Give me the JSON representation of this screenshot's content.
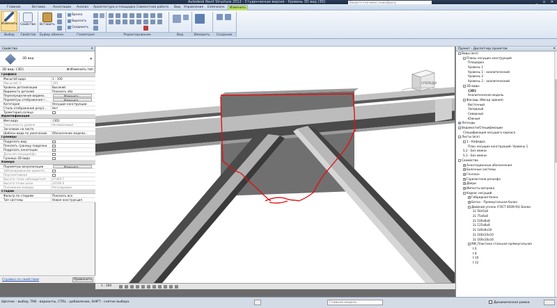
{
  "window": {
    "title": "Autodesk Revit Structure 2012 - Студенческая версия - Уровень 3D вид (3D)",
    "search_placeholder": "Введите ключевое слово/фразу",
    "controls": "_ ▫ ✕"
  },
  "ribbon_tabs": [
    "Главная",
    "Вставка",
    "Аннотации",
    "Анализ",
    "Архитектура и площадка",
    "Совместная работа",
    "Вид",
    "Управление",
    "Extensions",
    "Изменить"
  ],
  "ribbon": {
    "modify_label": "Изменить",
    "panels": {
      "select": "Выбор",
      "properties": "Свойства",
      "clipboard": "Буфер обмена",
      "geometry": "Геометрия",
      "modify": "Редактирование",
      "view": "Вид",
      "measure": "Измерить",
      "create": "Создание"
    },
    "buttons": {
      "properties": "Свойства",
      "paste": "Вставить",
      "cut": "Вырезать",
      "join": "Соединить",
      "cope": "Врезка"
    }
  },
  "properties": {
    "header": "Свойства",
    "type_name": "3D вид",
    "selector": "3D вид: {3D}",
    "edit_type": "Изменить тип",
    "groups": [
      {
        "name": "Графика",
        "rows": [
          {
            "n": "Масштаб вида",
            "v": "1 : 100",
            "kind": "text"
          },
          {
            "n": "Масштаб: 1:",
            "v": "100",
            "kind": "text",
            "dim": true
          },
          {
            "n": "Уровень детализации",
            "v": "Высокий",
            "kind": "text"
          },
          {
            "n": "Видимость деталей",
            "v": "Показать обо",
            "kind": "text"
          },
          {
            "n": "Переопределения видимо...",
            "v": "Изменить...",
            "kind": "btn"
          },
          {
            "n": "Параметры отображения г...",
            "v": "Изменить...",
            "kind": "btn"
          },
          {
            "n": "Категория",
            "v": "Несущие конструкции",
            "kind": "text"
          },
          {
            "n": "Стиль отображения резул...",
            "v": "Нет",
            "kind": "text"
          },
          {
            "n": "Траектория солнца",
            "v": "",
            "kind": "chk"
          }
        ]
      },
      {
        "name": "Идентификация",
        "rows": [
          {
            "n": "Имя вида",
            "v": "{3D}",
            "kind": "text"
          },
          {
            "n": "Зависимость уровня",
            "v": "Независимый",
            "kind": "text",
            "dim": true
          },
          {
            "n": "Заголовок на листе",
            "v": "",
            "kind": "text"
          },
          {
            "n": "Шаблон вида по умолчанию",
            "v": "Обозначение модели...",
            "kind": "text"
          }
        ]
      },
      {
        "name": "Границы",
        "rows": [
          {
            "n": "Подрезать вид",
            "v": "",
            "kind": "chk"
          },
          {
            "n": "Показать границу подрезки",
            "v": "",
            "kind": "chk"
          },
          {
            "n": "Подрезать аннотации",
            "v": "",
            "kind": "chk"
          },
          {
            "n": "Дальняя секущая(фн",
            "v": "",
            "kind": "chk",
            "dim": true
          },
          {
            "n": "Граница 3D вида",
            "v": "",
            "kind": "chk"
          }
        ]
      },
      {
        "name": "Камера",
        "rows": [
          {
            "n": "Параметры визуализации",
            "v": "Изменить...",
            "kind": "btn"
          },
          {
            "n": "Заблокированная ориента...",
            "v": "",
            "kind": "chk",
            "dim": true
          },
          {
            "n": "Перспективная",
            "v": "",
            "kind": "chk",
            "dim": true
          },
          {
            "n": "Высота глаза наблюдателя",
            "v": "67464.7",
            "kind": "text",
            "dim": true
          },
          {
            "n": "Высота точки цели",
            "v": "24190.0",
            "kind": "text",
            "dim": true
          },
          {
            "n": "Положение камеры",
            "v": "Регулировка",
            "kind": "text",
            "dim": true
          }
        ]
      },
      {
        "name": "Стадии",
        "rows": [
          {
            "n": "Фильтр по стадиям",
            "v": "Показать все",
            "kind": "text"
          },
          {
            "n": "Тип системы",
            "v": "Новая конструкция",
            "kind": "text"
          }
        ]
      }
    ],
    "help_link": "Справка по свойствам",
    "apply": "Применить"
  },
  "viewport": {
    "scale": "1 : 100",
    "viewcube_label": "СПЕРЕДИ",
    "colors": {
      "steel_light": "#b9b9b9",
      "steel_dark": "#3d3d3d",
      "plate": "#6f6f6f",
      "markup": "#e01010"
    }
  },
  "browser": {
    "header": "Проект - Диспетчер проектов",
    "tree": [
      {
        "t": "Виды (все)",
        "lvl": 0,
        "exp": "-"
      },
      {
        "t": "Планы несущих конструкций",
        "lvl": 1,
        "exp": "-"
      },
      {
        "t": "Площадка",
        "lvl": 2
      },
      {
        "t": "Уровень 1",
        "lvl": 2
      },
      {
        "t": "Уровень 1 - аналитический",
        "lvl": 2
      },
      {
        "t": "Уровень 2",
        "lvl": 2
      },
      {
        "t": "Уровень 2 - аналитический",
        "lvl": 2
      },
      {
        "t": "3D виды",
        "lvl": 1,
        "exp": "-"
      },
      {
        "t": "{3D}",
        "lvl": 2,
        "bold": true
      },
      {
        "t": "Аналитическая модель",
        "lvl": 2
      },
      {
        "t": "Фасады (Фасад здания)",
        "lvl": 1,
        "exp": "-"
      },
      {
        "t": "Восточный",
        "lvl": 2
      },
      {
        "t": "Западный",
        "lvl": 2
      },
      {
        "t": "Северный",
        "lvl": 2
      },
      {
        "t": "Южный",
        "lvl": 2
      },
      {
        "t": "Легенды",
        "lvl": 0,
        "ico": true
      },
      {
        "t": "Ведомости/Спецификации",
        "lvl": 0,
        "exp": "-"
      },
      {
        "t": "Спецификация несущего каркаса",
        "lvl": 1
      },
      {
        "t": "Листы (все)",
        "lvl": 0,
        "exp": "-"
      },
      {
        "t": "1 - Кафедра",
        "lvl": 1,
        "exp": "-"
      },
      {
        "t": "План несущих конструкций: Уровень 1",
        "lvl": 2
      },
      {
        "t": "S.2 - Без имени",
        "lvl": 1
      },
      {
        "t": "S.3 - Без имени",
        "lvl": 1
      },
      {
        "t": "Семейства",
        "lvl": 0,
        "exp": "-"
      },
      {
        "t": "Аннотационные обозначения",
        "lvl": 1,
        "exp": "+"
      },
      {
        "t": "Балочные системы",
        "lvl": 1,
        "exp": "+"
      },
      {
        "t": "Генплан",
        "lvl": 1,
        "exp": "+"
      },
      {
        "t": "Горизонтали рельефа",
        "lvl": 1,
        "exp": "+"
      },
      {
        "t": "Двери",
        "lvl": 1,
        "exp": "+"
      },
      {
        "t": "Импосты витража",
        "lvl": 1,
        "exp": "+"
      },
      {
        "t": "Каркас несущий",
        "lvl": 1,
        "exp": "-"
      },
      {
        "t": "Гибридная балка",
        "lvl": 2,
        "exp": "+"
      },
      {
        "t": "Бетон - Прямоугольная балка",
        "lvl": 2,
        "exp": "+"
      },
      {
        "t": "Двойной уголок (ГОСТ 8509-93) Балки",
        "lvl": 2,
        "exp": "-"
      },
      {
        "t": "2L 50x5x8",
        "lvl": 3
      },
      {
        "t": "2L 75x6x8",
        "lvl": 3
      },
      {
        "t": "2L 100x8x8",
        "lvl": 3
      },
      {
        "t": "2L 125x8x8",
        "lvl": 3
      },
      {
        "t": "2L 140x9x10",
        "lvl": 3
      },
      {
        "t": "2L 160x10x10",
        "lvl": 3
      },
      {
        "t": "2L 160x16x16",
        "lvl": 3
      },
      {
        "t": "МИ_Пластина стальная прямоугольная",
        "lvl": 2,
        "exp": "-"
      },
      {
        "t": "t 6",
        "lvl": 3
      },
      {
        "t": "t 8",
        "lvl": 3
      },
      {
        "t": "t 10",
        "lvl": 3
      },
      {
        "t": "t 12",
        "lvl": 3
      }
    ]
  },
  "status": {
    "message": "Щелчок - выбор, TAB - варианты, CTRL - добавление, SHIFT - снятие выбора.",
    "model": "Главная модель",
    "dynamic": "Динамическое рамка"
  }
}
